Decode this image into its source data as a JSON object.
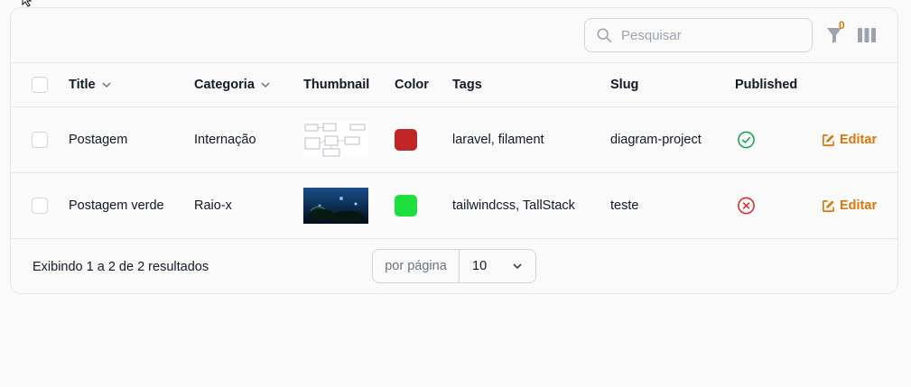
{
  "search": {
    "placeholder": "Pesquisar"
  },
  "filters": {
    "active_count": "0"
  },
  "columns": {
    "title": "Title",
    "category": "Categoria",
    "thumbnail": "Thumbnail",
    "color": "Color",
    "tags": "Tags",
    "slug": "Slug",
    "published": "Published"
  },
  "rows": [
    {
      "title": "Postagem",
      "category": "Internação",
      "color": "#c02626",
      "tags": "laravel, filament",
      "slug": "diagram-project",
      "published": true,
      "edit_label": "Editar"
    },
    {
      "title": "Postagem verde",
      "category": "Raio-x",
      "color": "#1ee03c",
      "tags": "tailwindcss, TallStack",
      "slug": "teste",
      "published": false,
      "edit_label": "Editar"
    }
  ],
  "footer": {
    "summary": "Exibindo 1 a 2 de 2 resultados",
    "per_page_label": "por página",
    "per_page_value": "10"
  },
  "colors": {
    "accent": "#d97706",
    "success": "#16a34a",
    "danger": "#dc2626"
  }
}
